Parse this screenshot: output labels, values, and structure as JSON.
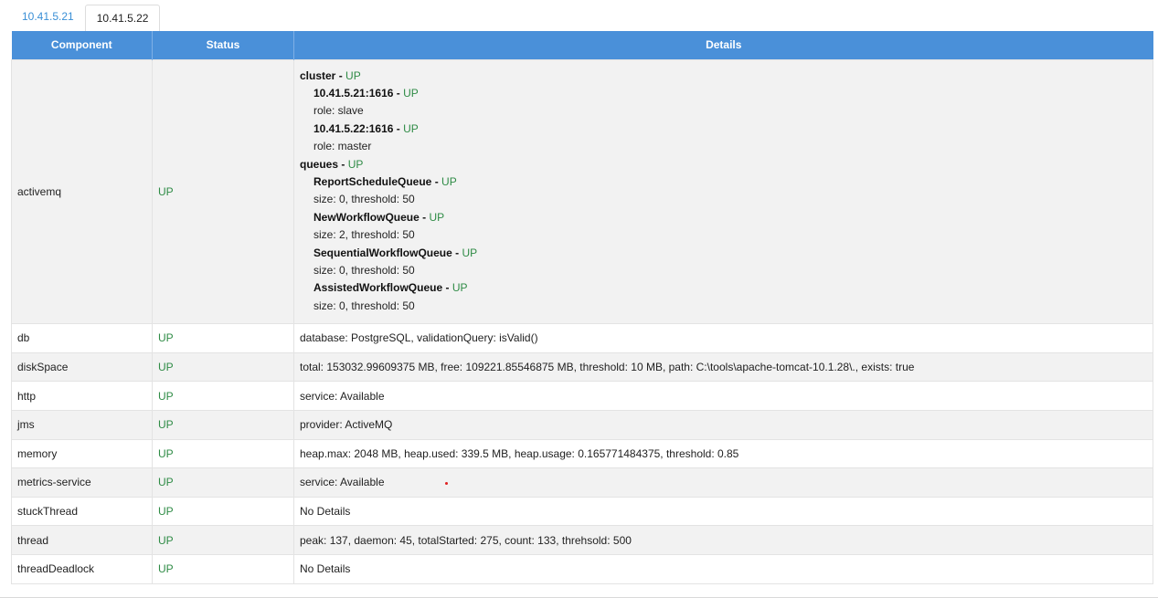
{
  "tabs": [
    {
      "label": "10.41.5.21",
      "active": false
    },
    {
      "label": "10.41.5.22",
      "active": true
    }
  ],
  "table": {
    "headers": {
      "component": "Component",
      "status": "Status",
      "details": "Details"
    }
  },
  "status_up": "UP",
  "activemq": {
    "component": "activemq",
    "status": "UP",
    "cluster": {
      "title": "cluster",
      "status": "UP",
      "nodes": [
        {
          "name": "10.41.5.21:1616",
          "status": "UP",
          "detail": "role: slave"
        },
        {
          "name": "10.41.5.22:1616",
          "status": "UP",
          "detail": "role: master"
        }
      ]
    },
    "queues": {
      "title": "queues",
      "status": "UP",
      "items": [
        {
          "name": "ReportScheduleQueue",
          "status": "UP",
          "detail": "size: 0, threshold: 50"
        },
        {
          "name": "NewWorkflowQueue",
          "status": "UP",
          "detail": "size: 2, threshold: 50"
        },
        {
          "name": "SequentialWorkflowQueue",
          "status": "UP",
          "detail": "size: 0, threshold: 50"
        },
        {
          "name": "AssistedWorkflowQueue",
          "status": "UP",
          "detail": "size: 0, threshold: 50"
        }
      ]
    }
  },
  "rows": [
    {
      "component": "db",
      "status": "UP",
      "details": "database: PostgreSQL, validationQuery: isValid()"
    },
    {
      "component": "diskSpace",
      "status": "UP",
      "details": "total: 153032.99609375 MB, free: 109221.85546875 MB, threshold: 10 MB, path: C:\\tools\\apache-tomcat-10.1.28\\., exists: true"
    },
    {
      "component": "http",
      "status": "UP",
      "details": "service: Available"
    },
    {
      "component": "jms",
      "status": "UP",
      "details": "provider: ActiveMQ"
    },
    {
      "component": "memory",
      "status": "UP",
      "details": "heap.max: 2048 MB, heap.used: 339.5 MB, heap.usage: 0.165771484375, threshold: 0.85"
    },
    {
      "component": "metrics-service",
      "status": "UP",
      "details": "service: Available"
    },
    {
      "component": "stuckThread",
      "status": "UP",
      "details": "No Details"
    },
    {
      "component": "thread",
      "status": "UP",
      "details": "peak: 137, daemon: 45, totalStarted: 275, count: 133, threhsold: 500"
    },
    {
      "component": "threadDeadlock",
      "status": "UP",
      "details": "No Details"
    }
  ],
  "colors": {
    "header_bg": "#4a90d9",
    "status_up": "#2e8b45",
    "tab_link": "#3a8fd6"
  }
}
